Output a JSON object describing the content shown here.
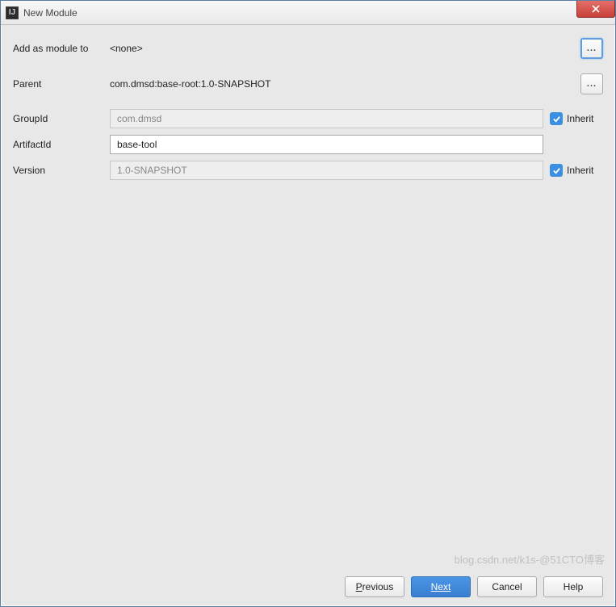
{
  "window": {
    "title": "New Module",
    "icon_glyph": "IJ"
  },
  "form": {
    "add_as_module": {
      "label": "Add as module to",
      "value": "<none>",
      "browse": "..."
    },
    "parent": {
      "label": "Parent",
      "value": "com.dmsd:base-root:1.0-SNAPSHOT",
      "browse": "..."
    },
    "group_id": {
      "label": "GroupId",
      "value": "com.dmsd",
      "inherit_label": "Inherit",
      "inherited": true
    },
    "artifact_id": {
      "label": "ArtifactId",
      "value": "base-tool"
    },
    "version": {
      "label": "Version",
      "value": "1.0-SNAPSHOT",
      "inherit_label": "Inherit",
      "inherited": true
    }
  },
  "buttons": {
    "previous": "Previous",
    "next": "Next",
    "cancel": "Cancel",
    "help": "Help"
  },
  "watermark": "blog.csdn.net/k1s-@51CTO博客"
}
